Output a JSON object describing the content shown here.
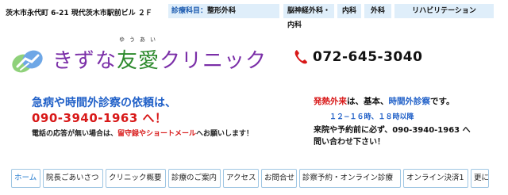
{
  "header": {
    "address": "茨木市永代町 6-21 現代茨木市駅前ビル ２Ｆ",
    "departments_label": "診療科目：",
    "departments_first": "整形外科",
    "neuro": "脳神経外科・内科",
    "internal": "内科",
    "surgery": "外科",
    "rehab": "リハビリテーション"
  },
  "logo": {
    "ruby": "ゆうあい",
    "name_part1": "きずな",
    "name_part2": "友愛",
    "name_part3": "クリニック"
  },
  "phone": {
    "number": "072-645-3040"
  },
  "emergency": {
    "line1": "急病や時間外診察の依頼は、",
    "phone_line": "090-3940-1963 へ！",
    "note_prefix": "電話の応答が無い場合は、",
    "note_red": "留守録やショートメール",
    "note_suffix": "へお願いします！"
  },
  "fever": {
    "red": "発熱外来",
    "mid": "は、基本、",
    "blue": "時間外診察",
    "end": "です。",
    "hours": "１２−１６時、１８時以降",
    "call1": "来院や予約前に必ず、090-3940-1963 へ",
    "call2": "問い合わせ下さい！"
  },
  "nav": {
    "items": [
      "ホーム",
      "院長ごあいさつ",
      "クリニック概要",
      "診療のご案内",
      "アクセス",
      "お問合せ",
      "診察予約・オンライン診療",
      "オンライン決済1",
      "更に"
    ]
  },
  "colors": {
    "accent_blue": "#2060c8",
    "alert_red": "#d81818",
    "logo_purple": "#7b2fa8",
    "logo_green": "#2d8a2d",
    "top_box_bg": "#dfeefa"
  }
}
